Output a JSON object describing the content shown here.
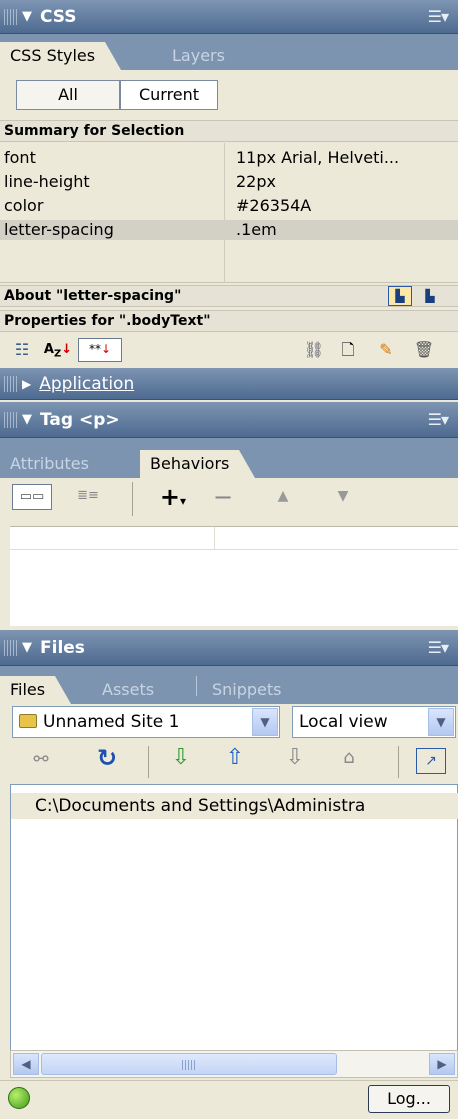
{
  "css_panel": {
    "title": "CSS",
    "tabs": [
      "CSS Styles",
      "Layers"
    ],
    "mode_buttons": [
      "All",
      "Current"
    ],
    "summary_title": "Summary for Selection",
    "summary_rows": [
      {
        "property": "font",
        "value": "11px Arial, Helveti..."
      },
      {
        "property": "line-height",
        "value": "22px"
      },
      {
        "property": "color",
        "value": "#26354A"
      },
      {
        "property": "letter-spacing",
        "value": ".1em"
      }
    ],
    "about_title": "About \"letter-spacing\"",
    "properties_title": "Properties for \".bodyText\""
  },
  "application_panel": {
    "title": "Application"
  },
  "tag_panel": {
    "title": "Tag <p>",
    "tabs": [
      "Attributes",
      "Behaviors"
    ]
  },
  "files_panel": {
    "title": "Files",
    "tabs": [
      "Files",
      "Assets",
      "Snippets"
    ],
    "site_select": "Unnamed Site 1",
    "view_select": "Local view",
    "path": "C:\\Documents and Settings\\Administra",
    "log_button": "Log..."
  },
  "colors": {
    "header_blue": "#5a7599",
    "tab_strip": "#7d94b1",
    "panel_bg": "#ece9d8"
  }
}
